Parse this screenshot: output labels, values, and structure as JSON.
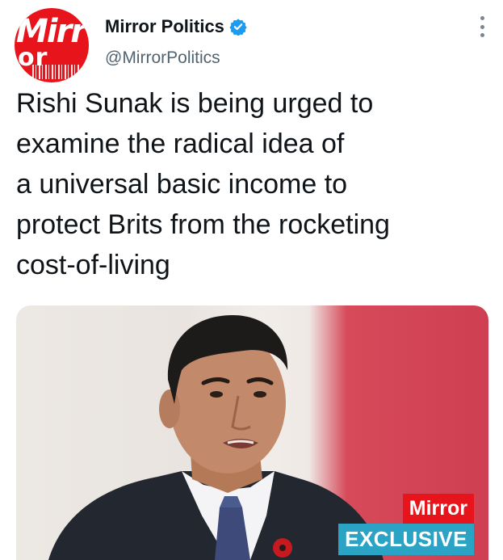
{
  "account": {
    "display_name": "Mirror Politics",
    "handle": "@MirrorPolitics",
    "verified": true,
    "avatar_text_top": "Mirr",
    "avatar_text_bottom": "or"
  },
  "tweet": {
    "text_lines": [
      "Rishi Sunak is being urged to",
      "examine the radical idea of",
      "a universal basic income to",
      "protect Brits from the rocketing",
      "cost-of-living"
    ]
  },
  "media": {
    "badge_brand": "Mirror",
    "badge_label": "EXCLUSIVE"
  },
  "colors": {
    "brand_red": "#e8141c",
    "verified_blue": "#1d9bf0",
    "exclusive_blue": "#2aa3c5"
  },
  "icons": {
    "verified": "verified-badge-icon",
    "more": "more-options-icon"
  }
}
